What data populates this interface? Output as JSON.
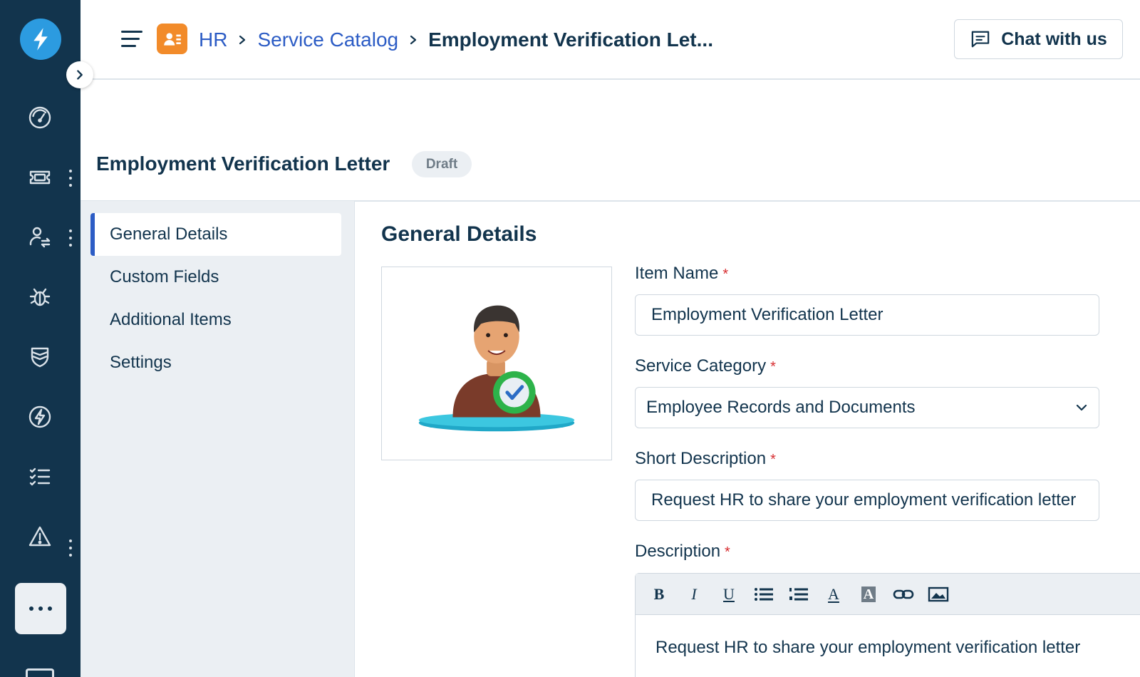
{
  "header": {
    "breadcrumb": {
      "root": "HR",
      "parent": "Service Catalog",
      "current": "Employment Verification Let..."
    },
    "chat_label": "Chat with us"
  },
  "page": {
    "title": "Employment Verification Letter",
    "status": "Draft"
  },
  "subnav": {
    "items": [
      {
        "label": "General Details",
        "active": true
      },
      {
        "label": "Custom Fields",
        "active": false
      },
      {
        "label": "Additional Items",
        "active": false
      },
      {
        "label": "Settings",
        "active": false
      }
    ]
  },
  "form": {
    "section_title": "General Details",
    "required_mark": "*",
    "item_name": {
      "label": "Item Name",
      "value": "Employment Verification Letter"
    },
    "service_category": {
      "label": "Service Category",
      "value": "Employee Records and Documents"
    },
    "short_description": {
      "label": "Short Description",
      "value": "Request HR to share your employment verification letter"
    },
    "description": {
      "label": "Description",
      "value": "Request HR to share your employment verification letter"
    }
  },
  "icons": {
    "rail": [
      "dashboard-icon",
      "tickets-icon",
      "changes-icon",
      "problems-icon",
      "releases-icon",
      "automation-icon",
      "tasks-icon",
      "alerts-icon"
    ],
    "toolbar": [
      "bold-icon",
      "italic-icon",
      "underline-icon",
      "bullet-list-icon",
      "numbered-list-icon",
      "font-color-icon",
      "highlight-icon",
      "link-icon",
      "image-icon"
    ]
  },
  "colors": {
    "rail_bg": "#12344d",
    "brand": "#2c9be0",
    "link": "#2c5cc5",
    "hr_icon": "#f28b2a",
    "required": "#d72d30"
  }
}
